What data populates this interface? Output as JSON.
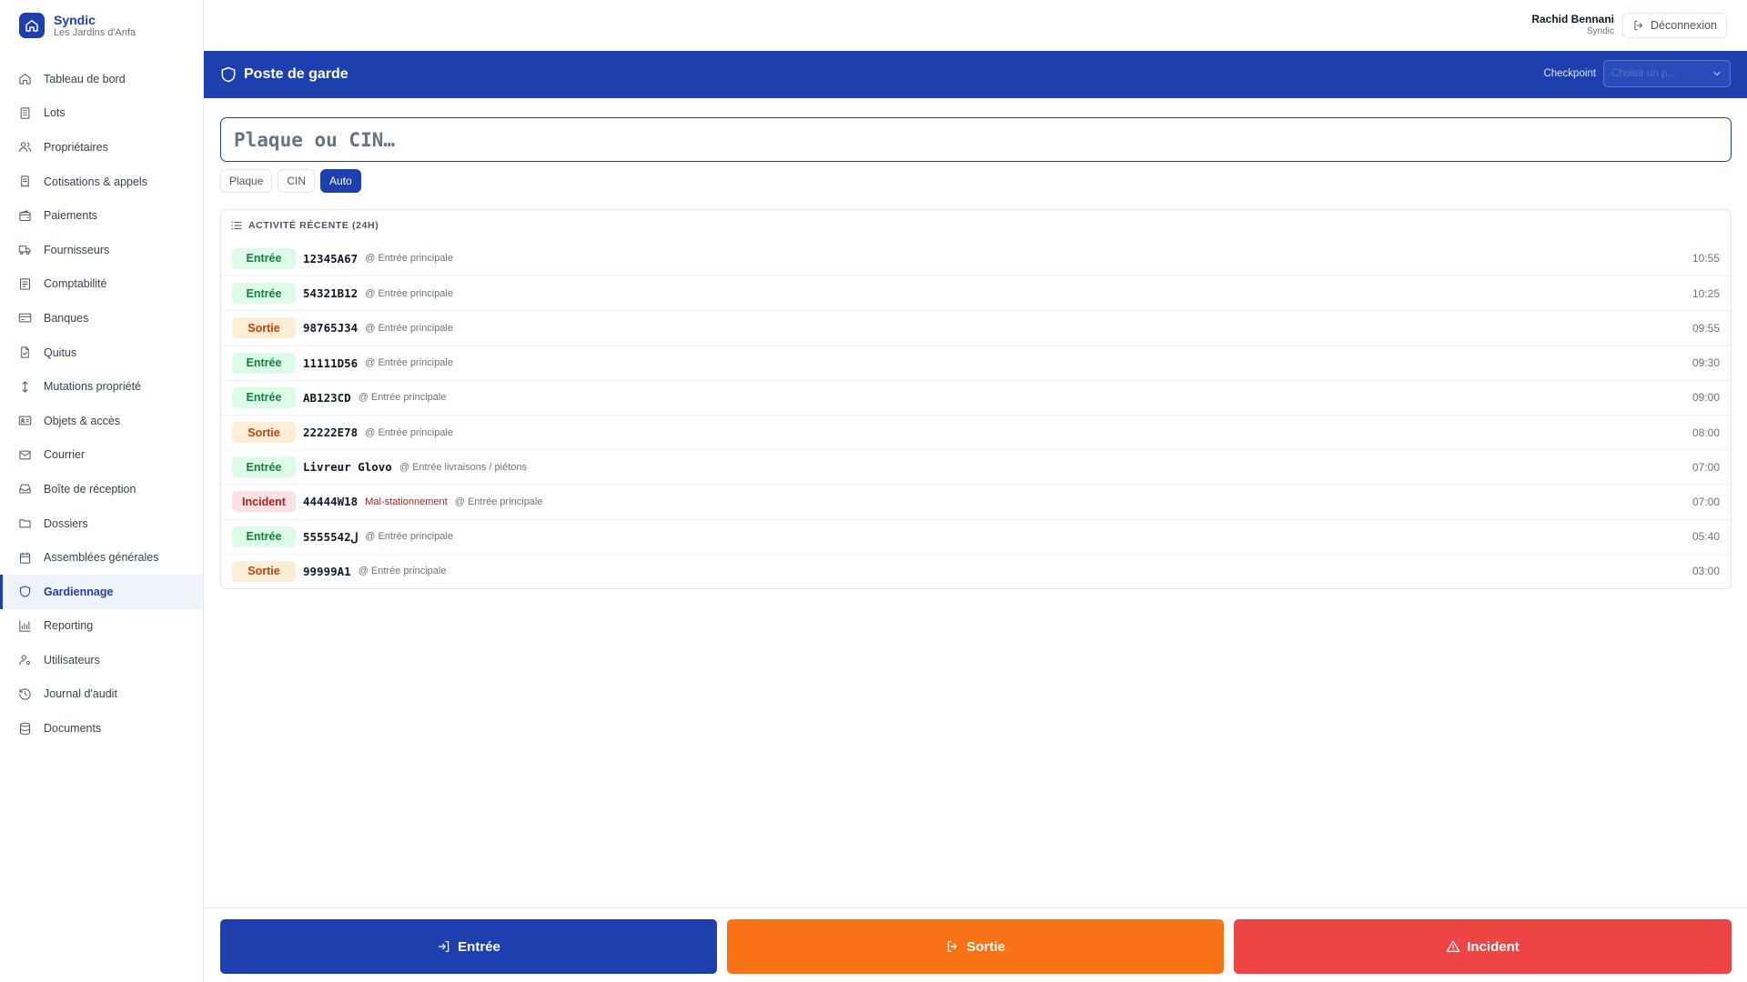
{
  "brand": {
    "title": "Syndic",
    "subtitle": "Les Jardins d'Anfa"
  },
  "user": {
    "name": "Rachid Bennani",
    "role": "Syndic",
    "logout_label": "Déconnexion"
  },
  "sidebar": {
    "items": [
      {
        "label": "Tableau de bord",
        "icon": "home-icon"
      },
      {
        "label": "Lots",
        "icon": "building-icon"
      },
      {
        "label": "Propriétaires",
        "icon": "users-icon"
      },
      {
        "label": "Cotisations & appels",
        "icon": "receipt-icon"
      },
      {
        "label": "Paiements",
        "icon": "wallet-icon"
      },
      {
        "label": "Fournisseurs",
        "icon": "truck-icon"
      },
      {
        "label": "Comptabilité",
        "icon": "ledger-icon"
      },
      {
        "label": "Banques",
        "icon": "card-icon"
      },
      {
        "label": "Quitus",
        "icon": "file-check-icon"
      },
      {
        "label": "Mutations propriété",
        "icon": "arrows-updown-icon"
      },
      {
        "label": "Objets & accès",
        "icon": "id-card-icon"
      },
      {
        "label": "Courrier",
        "icon": "mail-icon"
      },
      {
        "label": "Boîte de réception",
        "icon": "inbox-icon"
      },
      {
        "label": "Dossiers",
        "icon": "folder-icon"
      },
      {
        "label": "Assemblées générales",
        "icon": "calendar-icon"
      },
      {
        "label": "Gardiennage",
        "icon": "shield-icon",
        "active": true
      },
      {
        "label": "Reporting",
        "icon": "bar-chart-icon"
      },
      {
        "label": "Utilisateurs",
        "icon": "user-cog-icon"
      },
      {
        "label": "Journal d'audit",
        "icon": "history-icon"
      },
      {
        "label": "Documents",
        "icon": "database-icon"
      }
    ]
  },
  "header": {
    "title": "Poste de garde",
    "checkpoint_label": "Checkpoint",
    "checkpoint_placeholder": "Choisir un p…"
  },
  "search": {
    "placeholder": "Plaque ou CIN…",
    "value": ""
  },
  "modes": [
    {
      "label": "Plaque",
      "active": false
    },
    {
      "label": "CIN",
      "active": false
    },
    {
      "label": "Auto",
      "active": true
    }
  ],
  "activity": {
    "title": "ACTIVITÉ RÉCENTE (24H)",
    "rows": [
      {
        "type": "Entrée",
        "kind": "entree",
        "id": "12345A67",
        "reason": "",
        "location": "@ Entrée principale",
        "time": "10:55"
      },
      {
        "type": "Entrée",
        "kind": "entree",
        "id": "54321B12",
        "reason": "",
        "location": "@ Entrée principale",
        "time": "10:25"
      },
      {
        "type": "Sortie",
        "kind": "sortie",
        "id": "98765J34",
        "reason": "",
        "location": "@ Entrée principale",
        "time": "09:55"
      },
      {
        "type": "Entrée",
        "kind": "entree",
        "id": "11111D56",
        "reason": "",
        "location": "@ Entrée principale",
        "time": "09:30"
      },
      {
        "type": "Entrée",
        "kind": "entree",
        "id": "AB123CD",
        "reason": "",
        "location": "@ Entrée principale",
        "time": "09:00"
      },
      {
        "type": "Sortie",
        "kind": "sortie",
        "id": "22222E78",
        "reason": "",
        "location": "@ Entrée principale",
        "time": "08:00"
      },
      {
        "type": "Entrée",
        "kind": "entree",
        "id": "Livreur Glovo",
        "reason": "",
        "location": "@ Entrée livraisons / piétons",
        "time": "07:00"
      },
      {
        "type": "Incident",
        "kind": "incident",
        "id": "44444W18",
        "reason": "Mal-stationnement",
        "location": "@ Entrée principale",
        "time": "07:00"
      },
      {
        "type": "Entrée",
        "kind": "entree",
        "id": "5555542ل",
        "reason": "",
        "location": "@ Entrée principale",
        "time": "05:40"
      },
      {
        "type": "Sortie",
        "kind": "sortie",
        "id": "99999A1",
        "reason": "",
        "location": "@ Entrée principale",
        "time": "03:00"
      }
    ]
  },
  "actions": {
    "entree_label": "Entrée",
    "sortie_label": "Sortie",
    "incident_label": "Incident"
  },
  "colors": {
    "primary": "#1e40af",
    "sortie": "#f97316",
    "incident": "#ef4444"
  }
}
